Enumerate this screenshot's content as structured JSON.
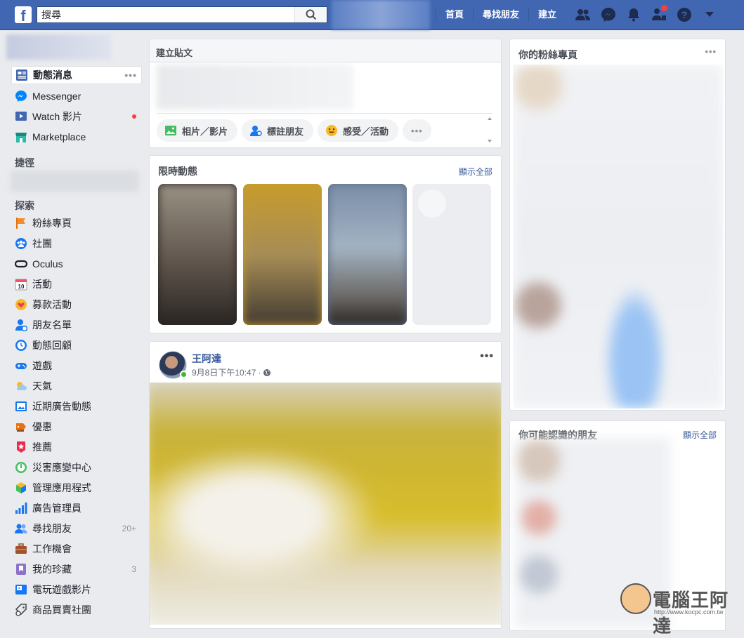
{
  "topbar": {
    "logo": "f",
    "search_placeholder": "搜尋",
    "nav": [
      "首頁",
      "尋找朋友",
      "建立"
    ],
    "colors": {
      "brand": "#4267b2",
      "notification": "#fa3e3e"
    }
  },
  "sidebar": {
    "main": [
      {
        "label": "動態消息",
        "icon": "news-feed-icon",
        "more": "•••"
      },
      {
        "label": "Messenger",
        "icon": "messenger-icon"
      },
      {
        "label": "Watch 影片",
        "icon": "watch-icon"
      },
      {
        "label": "Marketplace",
        "icon": "marketplace-icon"
      }
    ],
    "shortcuts_heading": "捷徑",
    "explore_heading": "探索",
    "explore": [
      {
        "label": "粉絲專頁",
        "icon": "flag-icon"
      },
      {
        "label": "社團",
        "icon": "groups-icon"
      },
      {
        "label": "Oculus",
        "icon": "oculus-icon"
      },
      {
        "label": "活動",
        "icon": "calendar-icon"
      },
      {
        "label": "募款活動",
        "icon": "fundraiser-icon"
      },
      {
        "label": "朋友名單",
        "icon": "friend-list-icon"
      },
      {
        "label": "動態回顧",
        "icon": "memories-icon"
      },
      {
        "label": "遊戲",
        "icon": "gamepad-icon"
      },
      {
        "label": "天氣",
        "icon": "weather-icon"
      },
      {
        "label": "近期廣告動態",
        "icon": "ad-activity-icon"
      },
      {
        "label": "優惠",
        "icon": "offers-icon"
      },
      {
        "label": "推薦",
        "icon": "recommendations-icon"
      },
      {
        "label": "災害應變中心",
        "icon": "crisis-response-icon"
      },
      {
        "label": "管理應用程式",
        "icon": "apps-icon"
      },
      {
        "label": "廣告管理員",
        "icon": "ads-manager-icon"
      },
      {
        "label": "尋找朋友",
        "icon": "find-friends-icon",
        "count": "20+"
      },
      {
        "label": "工作機會",
        "icon": "jobs-icon"
      },
      {
        "label": "我的珍藏",
        "icon": "saved-icon",
        "count": "3"
      },
      {
        "label": "電玩遊戲影片",
        "icon": "gaming-video-icon"
      },
      {
        "label": "商品買賣社團",
        "icon": "buy-sell-icon"
      }
    ]
  },
  "composer": {
    "title": "建立貼文",
    "actions": [
      "相片／影片",
      "標註朋友",
      "感受／活動"
    ],
    "more": "•••"
  },
  "stories": {
    "title": "限時動態",
    "link": "顯示全部"
  },
  "post": {
    "author": "王阿達",
    "time": "9月8日下午10:47",
    "separator": "·",
    "more": "•••"
  },
  "right": {
    "pages_title": "你的粉絲專頁",
    "pages_more": "•••",
    "friends_title": "你可能認識的朋友",
    "friends_link": "顯示全部"
  },
  "watermark": {
    "text": "電腦王阿達",
    "url": "http://www.kocpc.com.tw"
  }
}
